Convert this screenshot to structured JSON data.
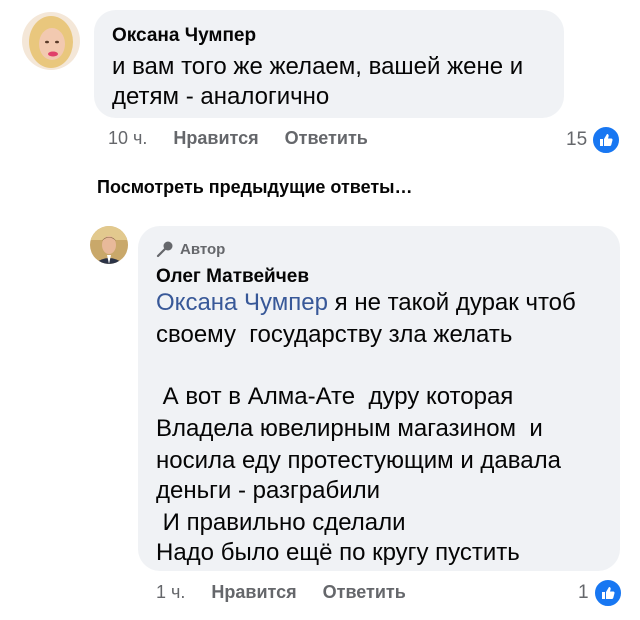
{
  "comment1": {
    "author": "Оксана Чумпер",
    "text_line1": "и вам того же желаем, вашей жене и",
    "text_line2": "детям - аналогично",
    "time": "10 ч.",
    "like_label": "Нравится",
    "reply_label": "Ответить",
    "reaction_count": "15"
  },
  "view_previous": "Посмотреть предыдущие ответы…",
  "comment2": {
    "badge": "Автор",
    "author": "Олег Матвейчев",
    "mention": "Оксана Чумпер",
    "line1_rest": " я не такой дурак чтоб",
    "line2": "своему  государству зла желать",
    "line3": " А вот в Алма-Ате  дуру которая",
    "line4": "Владела ювелирным магазином  и",
    "line5": "носила еду протестующим и давала",
    "line6": "деньги - разграбили",
    "line7": " И правильно сделали",
    "line8": "Надо было ещё по кругу пустить",
    "time": "1 ч.",
    "like_label": "Нравится",
    "reply_label": "Ответить",
    "reaction_count": "1"
  },
  "colors": {
    "bubble": "#f0f2f5",
    "link": "#385898",
    "like": "#1877f2",
    "meta": "#65676b"
  }
}
